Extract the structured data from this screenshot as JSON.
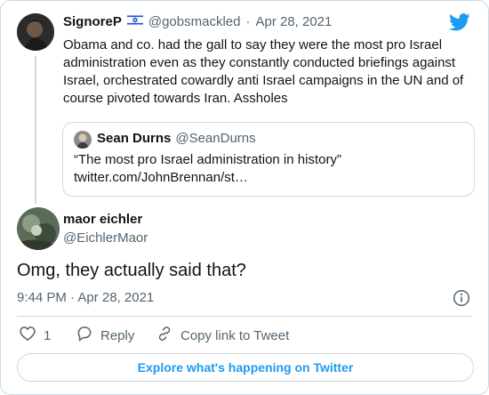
{
  "colors": {
    "accent": "#1d9bf0",
    "text": "#0f1419",
    "muted": "#536471",
    "border": "#cfd9de"
  },
  "parent_tweet": {
    "author_name": "SignoreP",
    "flag_icon": "israel-flag-icon",
    "handle": "@gobsmackled",
    "separator": "·",
    "date": "Apr 28, 2021",
    "text": "Obama and co. had the gall to say they were the most pro Israel\nadministration even as they constantly conducted briefings against\nIsrael, orchestrated cowardly anti Israel campaigns in the UN and of\ncourse pivoted towards Iran. Assholes"
  },
  "quoted_tweet": {
    "author_name": "Sean Durns",
    "handle": "@SeanDurns",
    "text": "“The most pro Israel administration in history”\ntwitter.com/JohnBrennan/st…"
  },
  "reply_tweet": {
    "author_name": "maor eichler",
    "handle": "@EichlerMaor",
    "text": "Omg, they actually said that?",
    "timestamp": "9:44 PM · Apr 28, 2021"
  },
  "actions": {
    "like_count": "1",
    "reply_label": "Reply",
    "copy_link_label": "Copy link to Tweet"
  },
  "explore_label": "Explore what's happening on Twitter",
  "icons": {
    "brand": "twitter-bird-icon",
    "like": "heart-icon",
    "reply": "speech-bubble-icon",
    "copy_link": "link-icon",
    "info": "info-icon"
  }
}
